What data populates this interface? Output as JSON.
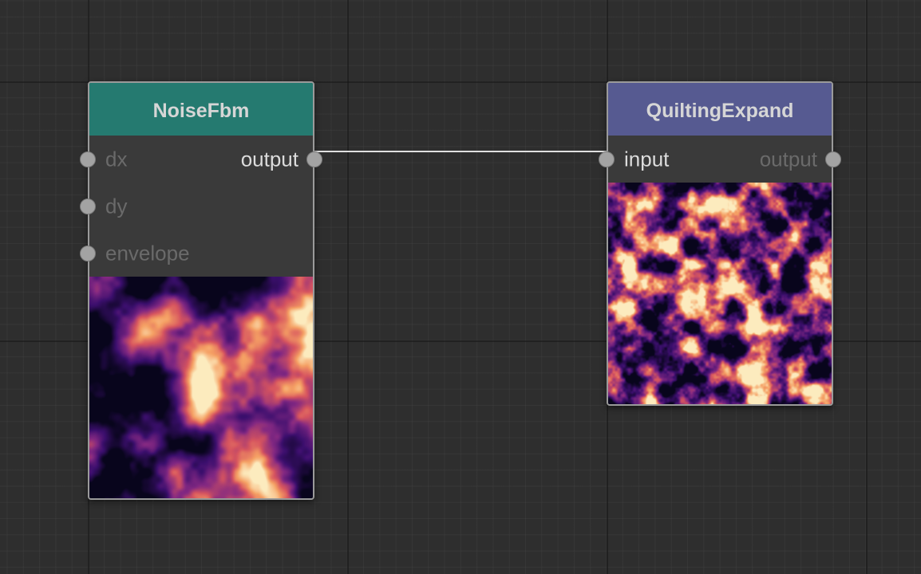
{
  "colors": {
    "noise_header": "#257a70",
    "quilting_header": "#565a91",
    "wire": "#e0e0e0"
  },
  "nodes": [
    {
      "title": "NoiseFbm",
      "inputs": [
        {
          "label": "dx",
          "connected": false
        },
        {
          "label": "dy",
          "connected": false
        },
        {
          "label": "envelope",
          "connected": false
        }
      ],
      "outputs": [
        {
          "label": "output",
          "connected": true
        }
      ],
      "preview": "fbm-noise-texture"
    },
    {
      "title": "QuiltingExpand",
      "inputs": [
        {
          "label": "input",
          "connected": true
        }
      ],
      "outputs": [
        {
          "label": "output",
          "connected": false
        }
      ],
      "preview": "quilted-noise-texture"
    }
  ],
  "connections": [
    {
      "from": "NoiseFbm.output",
      "to": "QuiltingExpand.input"
    }
  ]
}
